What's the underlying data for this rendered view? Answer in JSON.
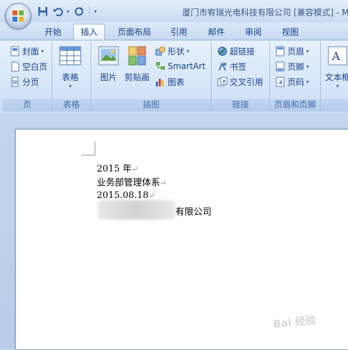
{
  "window": {
    "title": "厦门市宥瑞光电科技有限公司 [兼容模式] - M",
    "office_button": "office-orb"
  },
  "quick_access": [
    {
      "name": "save-icon",
      "glyph": "💾"
    },
    {
      "name": "undo-icon",
      "glyph": "↶"
    },
    {
      "name": "redo-icon",
      "glyph": "↷"
    },
    {
      "name": "customize-icon",
      "glyph": "▾"
    }
  ],
  "tabs": [
    "开始",
    "插入",
    "页面布局",
    "引用",
    "邮件",
    "审阅",
    "视图"
  ],
  "active_tab": "插入",
  "ribbon": {
    "pages": {
      "label": "页",
      "items": [
        "封面",
        "空白页",
        "分页"
      ]
    },
    "table": {
      "label": "表格",
      "item": "表格"
    },
    "illustrations": {
      "label": "插图",
      "picture": "图片",
      "clipart": "剪贴画",
      "shapes": "形状",
      "smartart": "SmartArt",
      "chart": "图表"
    },
    "links": {
      "label": "链接",
      "items": [
        "超链接",
        "书签",
        "交叉引用"
      ]
    },
    "header_footer": {
      "label": "页眉和页脚",
      "items": [
        "页眉",
        "页脚",
        "页码"
      ]
    },
    "text": {
      "item": "文本框"
    }
  },
  "document": {
    "lines": [
      "2015 年",
      "业务部管理体系",
      "2015.08.18",
      "有限公司"
    ],
    "paragraph_mark": "↵"
  },
  "watermark": "Bai 经验"
}
